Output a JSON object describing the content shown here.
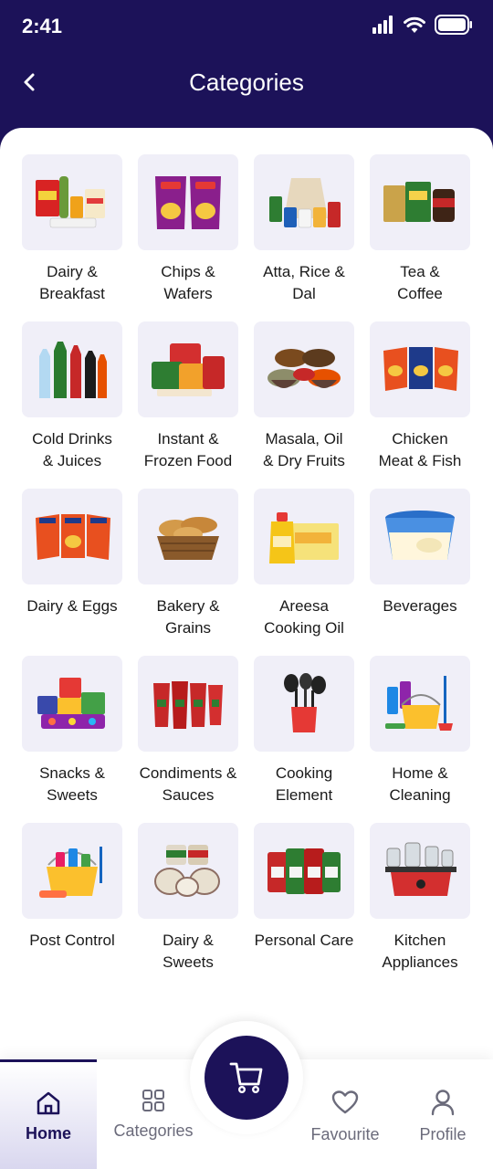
{
  "status_bar": {
    "time": "2:41"
  },
  "header": {
    "title": "Categories"
  },
  "categories": [
    {
      "label": "Dairy &\nBreakfast",
      "icon": "cereal-boxes-icon"
    },
    {
      "label": "Chips &\nWafers",
      "icon": "chips-packets-icon"
    },
    {
      "label": "Atta, Rice &\nDal",
      "icon": "grain-sacks-icon"
    },
    {
      "label": "Tea &\nCoffee",
      "icon": "tea-coffee-packs-icon"
    },
    {
      "label": "Cold Drinks\n& Juices",
      "icon": "soda-bottles-icon"
    },
    {
      "label": "Instant &\nFrozen Food",
      "icon": "instant-food-packs-icon"
    },
    {
      "label": "Masala, Oil\n& Dry Fruits",
      "icon": "spice-bowls-icon"
    },
    {
      "label": "Chicken\nMeat & Fish",
      "icon": "snack-packets-icon"
    },
    {
      "label": "Dairy & Eggs",
      "icon": "snack-packets-icon"
    },
    {
      "label": "Bakery &\nGrains",
      "icon": "bread-basket-icon"
    },
    {
      "label": "Areesa\nCooking Oil",
      "icon": "oil-bottle-icon"
    },
    {
      "label": "Beverages",
      "icon": "ice-cream-tub-icon"
    },
    {
      "label": "Snacks &\nSweets",
      "icon": "sweets-pile-icon"
    },
    {
      "label": "Condiments &\nSauces",
      "icon": "sauce-pouches-icon"
    },
    {
      "label": "Cooking\nElement",
      "icon": "kitchen-utensils-icon"
    },
    {
      "label": "Home &\nCleaning",
      "icon": "cleaning-bucket-icon"
    },
    {
      "label": "Post Control",
      "icon": "cleaning-supplies-icon"
    },
    {
      "label": "Dairy &\nSweets",
      "icon": "sweet-tins-icon"
    },
    {
      "label": "Personal Care",
      "icon": "rice-bags-icon"
    },
    {
      "label": "Kitchen\nAppliances",
      "icon": "mixer-grinder-icon"
    }
  ],
  "bottom_nav": {
    "home": "Home",
    "categories": "Categories",
    "favourite": "Favourite",
    "profile": "Profile"
  },
  "colors": {
    "brand": "#1c1259",
    "tile_bg": "#f0eff8"
  }
}
